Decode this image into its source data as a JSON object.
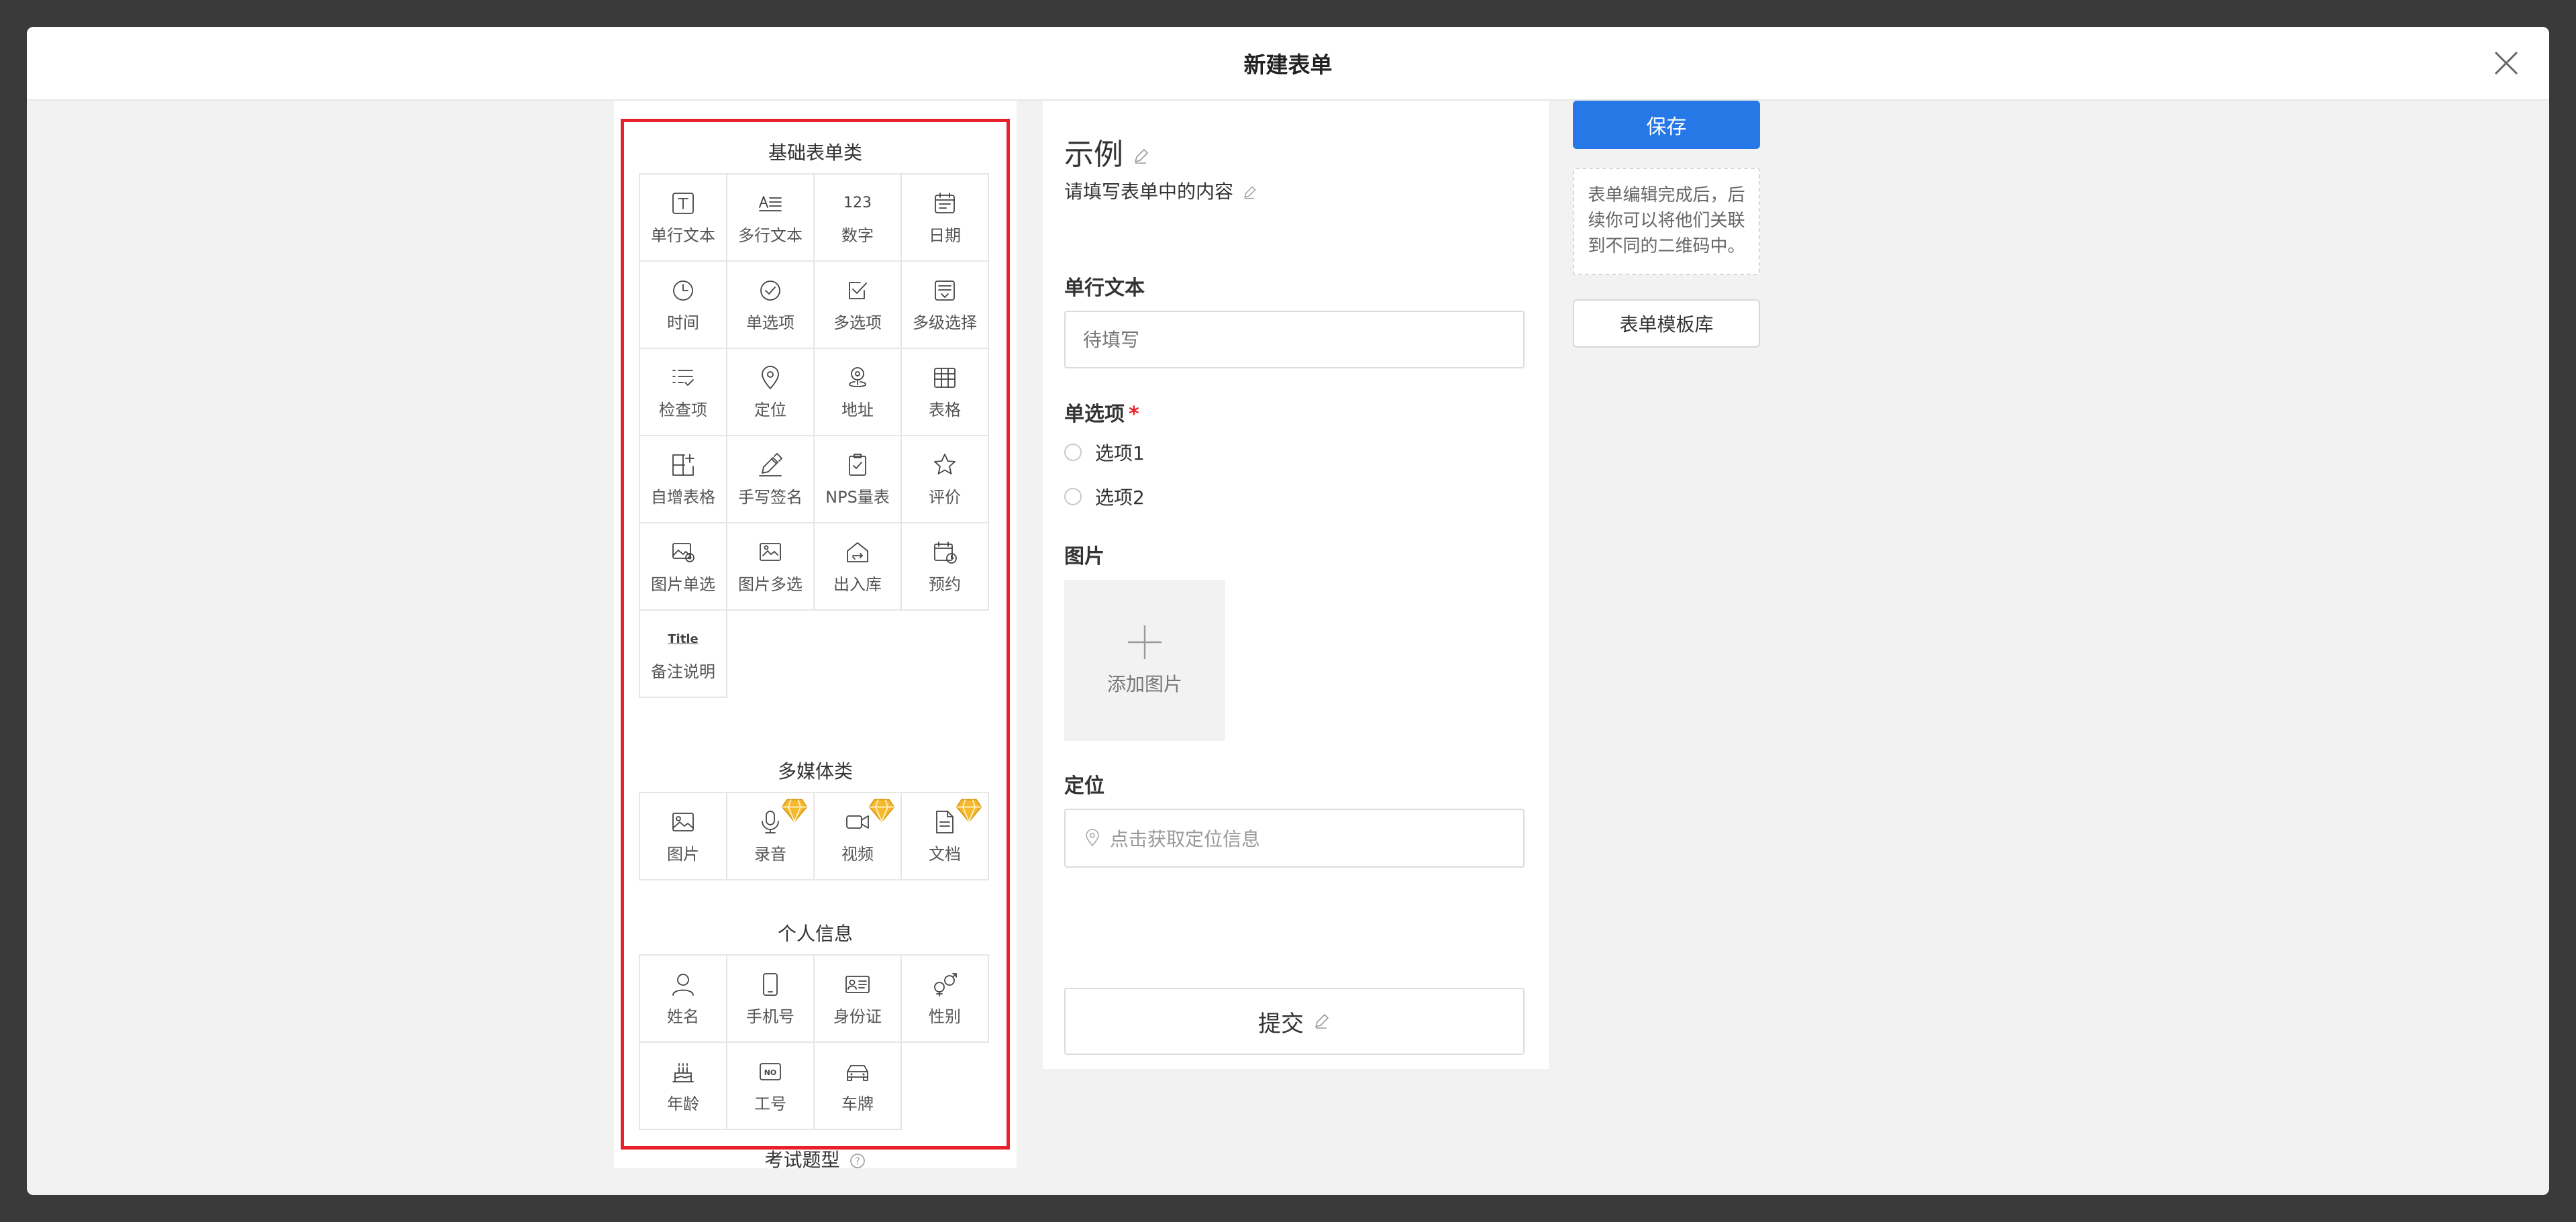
{
  "dialog": {
    "title": "新建表单"
  },
  "palette": {
    "basic": {
      "title": "基础表单类",
      "items": [
        {
          "label": "单行文本",
          "icon": "text-field-icon"
        },
        {
          "label": "多行文本",
          "icon": "multiline-text-icon"
        },
        {
          "label": "数字",
          "icon": "number-icon",
          "icon_text": "123"
        },
        {
          "label": "日期",
          "icon": "calendar-icon"
        },
        {
          "label": "时间",
          "icon": "clock-icon"
        },
        {
          "label": "单选项",
          "icon": "radio-check-icon"
        },
        {
          "label": "多选项",
          "icon": "checkbox-icon"
        },
        {
          "label": "多级选择",
          "icon": "cascade-select-icon"
        },
        {
          "label": "检查项",
          "icon": "checklist-icon"
        },
        {
          "label": "定位",
          "icon": "location-pin-icon"
        },
        {
          "label": "地址",
          "icon": "address-icon"
        },
        {
          "label": "表格",
          "icon": "table-icon"
        },
        {
          "label": "自增表格",
          "icon": "table-add-icon"
        },
        {
          "label": "手写签名",
          "icon": "signature-pen-icon"
        },
        {
          "label": "NPS量表",
          "icon": "nps-scale-icon"
        },
        {
          "label": "评价",
          "icon": "star-icon"
        },
        {
          "label": "图片单选",
          "icon": "image-single-icon"
        },
        {
          "label": "图片多选",
          "icon": "image-multi-icon"
        },
        {
          "label": "出入库",
          "icon": "warehouse-icon"
        },
        {
          "label": "预约",
          "icon": "booking-calendar-icon"
        },
        {
          "label": "备注说明",
          "icon": "title-icon",
          "icon_text": "Title"
        }
      ]
    },
    "media": {
      "title": "多媒体类",
      "items": [
        {
          "label": "图片",
          "icon": "image-icon",
          "vip": false
        },
        {
          "label": "录音",
          "icon": "microphone-icon",
          "vip": true
        },
        {
          "label": "视频",
          "icon": "video-icon",
          "vip": true
        },
        {
          "label": "文档",
          "icon": "document-icon",
          "vip": true
        }
      ]
    },
    "personal": {
      "title": "个人信息",
      "items": [
        {
          "label": "姓名",
          "icon": "person-icon"
        },
        {
          "label": "手机号",
          "icon": "phone-icon"
        },
        {
          "label": "身份证",
          "icon": "id-card-icon"
        },
        {
          "label": "性别",
          "icon": "gender-icon"
        },
        {
          "label": "年龄",
          "icon": "cake-icon"
        },
        {
          "label": "工号",
          "icon": "badge-number-icon",
          "icon_text": "NO"
        },
        {
          "label": "车牌",
          "icon": "car-icon"
        }
      ]
    },
    "exam": {
      "title": "考试题型"
    }
  },
  "preview": {
    "title": "示例",
    "subtitle": "请填写表单中的内容",
    "text_field": {
      "label": "单行文本",
      "placeholder": "待填写"
    },
    "radio_field": {
      "label": "单选项",
      "required_mark": "*",
      "options": [
        "选项1",
        "选项2"
      ]
    },
    "image_field": {
      "label": "图片",
      "upload_label": "添加图片"
    },
    "location_field": {
      "label": "定位",
      "placeholder": "点击获取定位信息"
    },
    "submit_label": "提交"
  },
  "side": {
    "save_label": "保存",
    "tip": "表单编辑完成后，后续你可以将他们关联到不同的二维码中。",
    "template_label": "表单模板库"
  },
  "colors": {
    "accent": "#2678e6",
    "highlight_border": "#e8202a",
    "vip": "#f5b82e"
  }
}
